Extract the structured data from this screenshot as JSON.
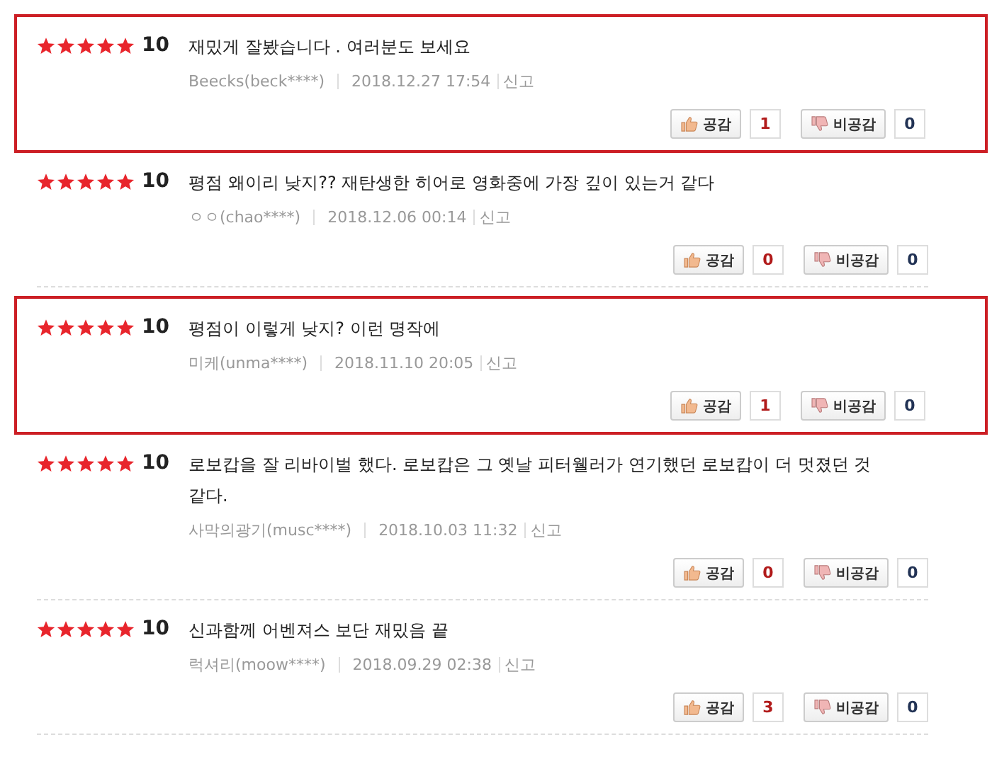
{
  "reviews": [
    {
      "highlighted": true,
      "stars": 5,
      "score": "10",
      "text": "재밌게 잘봤습니다 . 여러분도 보세요",
      "author": "Beecks(beck****)",
      "date": "2018.12.27 17:54",
      "report": "신고",
      "like_label": "공감",
      "like_count": "1",
      "dislike_label": "비공감",
      "dislike_count": "0"
    },
    {
      "highlighted": false,
      "stars": 5,
      "score": "10",
      "text": "평점 왜이리 낮지?? 재탄생한 히어로 영화중에 가장 깊이 있는거 같다",
      "author": "ㅇㅇ(chao****)",
      "date": "2018.12.06 00:14",
      "report": "신고",
      "like_label": "공감",
      "like_count": "0",
      "dislike_label": "비공감",
      "dislike_count": "0"
    },
    {
      "highlighted": true,
      "stars": 5,
      "score": "10",
      "text": "평점이 이렇게 낮지? 이런 명작에",
      "author": "미케(unma****)",
      "date": "2018.11.10 20:05",
      "report": "신고",
      "like_label": "공감",
      "like_count": "1",
      "dislike_label": "비공감",
      "dislike_count": "0"
    },
    {
      "highlighted": false,
      "stars": 5,
      "score": "10",
      "text": "로보캅을 잘 리바이벌 했다. 로보캅은 그 옛날 피터웰러가 연기했던 로보캅이 더 멋졌던 것 같다.",
      "author": "사막의광기(musc****)",
      "date": "2018.10.03 11:32",
      "report": "신고",
      "like_label": "공감",
      "like_count": "0",
      "dislike_label": "비공감",
      "dislike_count": "0"
    },
    {
      "highlighted": false,
      "stars": 5,
      "score": "10",
      "text": "신과함께 어벤져스 보단 재밌음 끝",
      "author": "럭셔리(moow****)",
      "date": "2018.09.29 02:38",
      "report": "신고",
      "like_label": "공감",
      "like_count": "3",
      "dislike_label": "비공감",
      "dislike_count": "0"
    }
  ]
}
